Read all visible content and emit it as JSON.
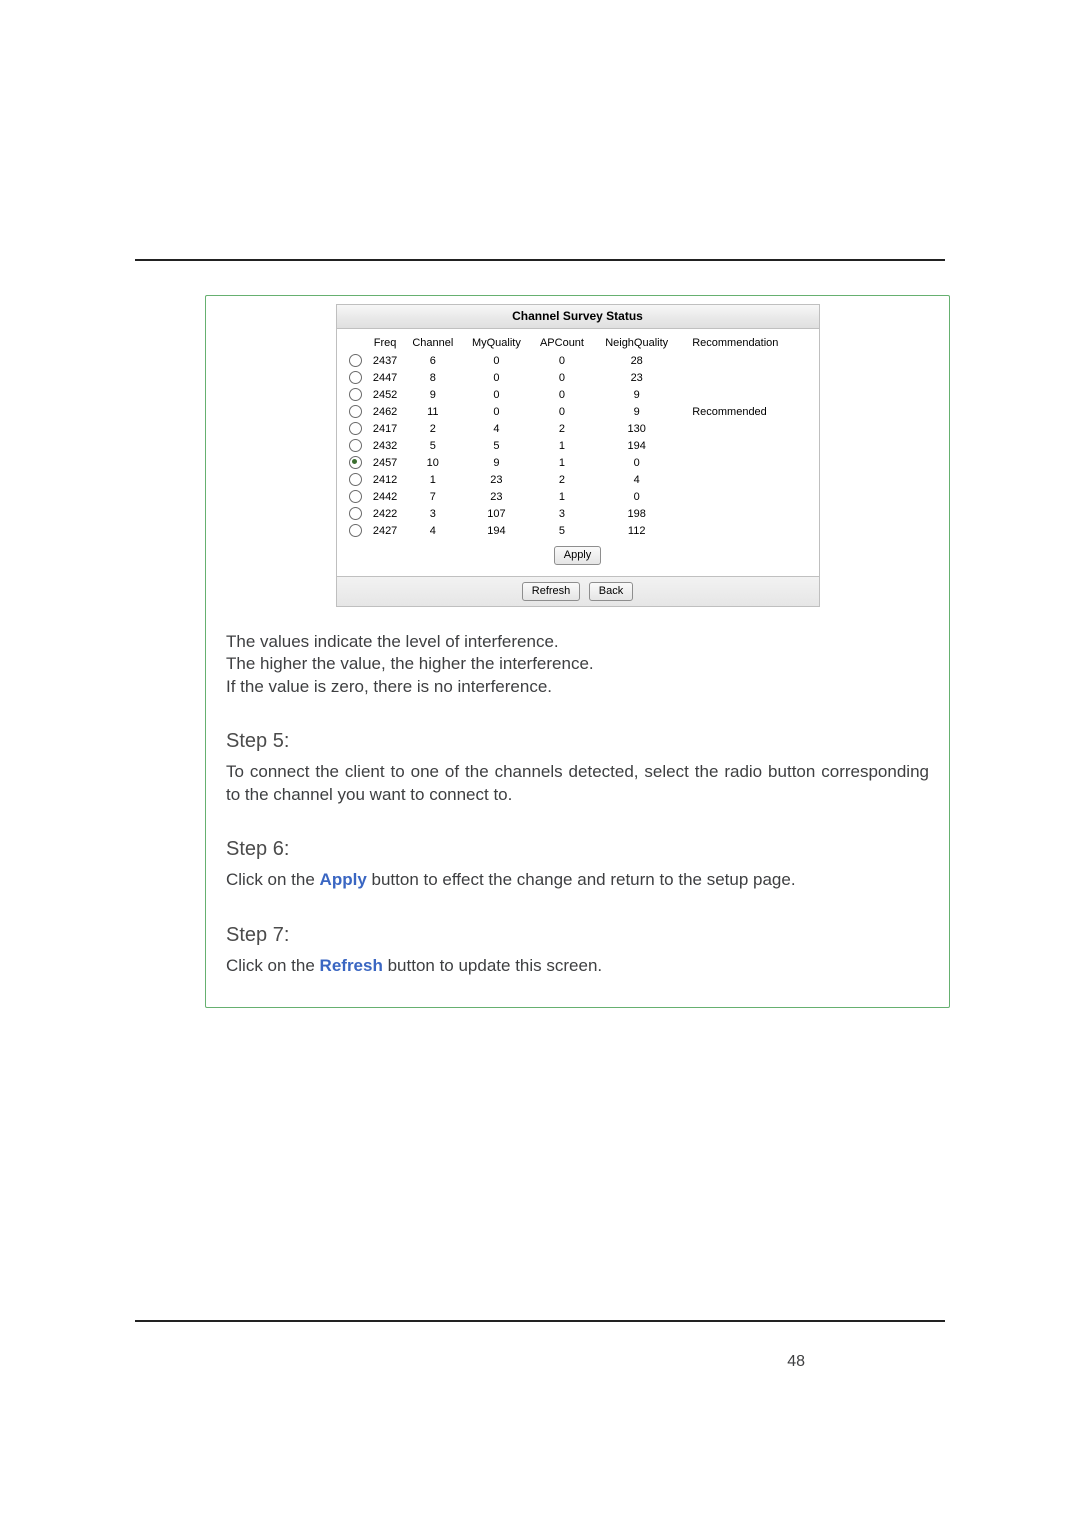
{
  "survey": {
    "title": "Channel Survey Status",
    "headers": [
      "",
      "Freq",
      "Channel",
      "MyQuality",
      "APCount",
      "NeighQuality",
      "Recommendation"
    ],
    "rows": [
      {
        "selected": false,
        "freq": "2437",
        "channel": "6",
        "myq": "0",
        "apc": "0",
        "neigh": "28",
        "rec": ""
      },
      {
        "selected": false,
        "freq": "2447",
        "channel": "8",
        "myq": "0",
        "apc": "0",
        "neigh": "23",
        "rec": ""
      },
      {
        "selected": false,
        "freq": "2452",
        "channel": "9",
        "myq": "0",
        "apc": "0",
        "neigh": "9",
        "rec": ""
      },
      {
        "selected": false,
        "freq": "2462",
        "channel": "11",
        "myq": "0",
        "apc": "0",
        "neigh": "9",
        "rec": "Recommended"
      },
      {
        "selected": false,
        "freq": "2417",
        "channel": "2",
        "myq": "4",
        "apc": "2",
        "neigh": "130",
        "rec": ""
      },
      {
        "selected": false,
        "freq": "2432",
        "channel": "5",
        "myq": "5",
        "apc": "1",
        "neigh": "194",
        "rec": ""
      },
      {
        "selected": true,
        "freq": "2457",
        "channel": "10",
        "myq": "9",
        "apc": "1",
        "neigh": "0",
        "rec": ""
      },
      {
        "selected": false,
        "freq": "2412",
        "channel": "1",
        "myq": "23",
        "apc": "2",
        "neigh": "4",
        "rec": ""
      },
      {
        "selected": false,
        "freq": "2442",
        "channel": "7",
        "myq": "23",
        "apc": "1",
        "neigh": "0",
        "rec": ""
      },
      {
        "selected": false,
        "freq": "2422",
        "channel": "3",
        "myq": "107",
        "apc": "3",
        "neigh": "198",
        "rec": ""
      },
      {
        "selected": false,
        "freq": "2427",
        "channel": "4",
        "myq": "194",
        "apc": "5",
        "neigh": "112",
        "rec": ""
      }
    ],
    "apply_label": "Apply",
    "refresh_label": "Refresh",
    "back_label": "Back"
  },
  "text": {
    "intf1": "The values indicate the level of interference.",
    "intf2": "The higher the value, the higher the interference.",
    "intf3": "If the value is zero, there is no interference.",
    "step5_title": "Step 5:",
    "step5_body": "To connect the client to one of the channels detected, select the radio button corresponding to the channel you want to connect to.",
    "step6_title": "Step 6:",
    "step6_pre": "Click on the ",
    "step6_kw": "Apply",
    "step6_post": " button to effect the change and return to the setup page.",
    "step7_title": "Step 7:",
    "step7_pre": "Click on the ",
    "step7_kw": "Refresh",
    "step7_post": " button to update this screen."
  },
  "page_number": "48"
}
